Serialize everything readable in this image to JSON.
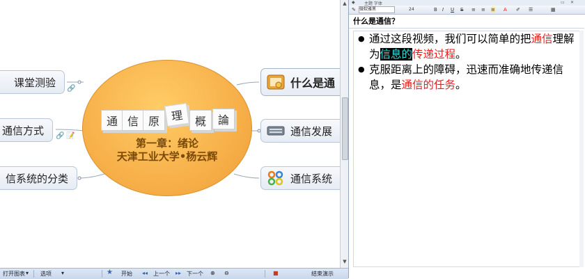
{
  "mindmap": {
    "central": {
      "cube_chars": [
        "通",
        "信",
        "原",
        "理",
        "概",
        "論"
      ],
      "line1": "第一章：绪论",
      "line2": "天津工业大学•杨云辉"
    },
    "left_topics": [
      {
        "label": "课堂测验"
      },
      {
        "label": "通信方式"
      },
      {
        "label": "信系统的分类"
      }
    ],
    "right_topics": [
      {
        "label": "什么是通",
        "icon": "picture-icon"
      },
      {
        "label": "通信发展",
        "icon": "keyboard-icon"
      },
      {
        "label": "通信系统",
        "icon": "network-icon"
      }
    ]
  },
  "statusbar": {
    "open_map": "打开图表",
    "options": "选项",
    "home": "开始",
    "prev": "上一个",
    "next": "下一个",
    "end_show": "结束演示"
  },
  "notes": {
    "toolbar_text": "主题  字体",
    "font_name": "微软雅黑",
    "font_size": "24",
    "title": "什么是通信？",
    "bullet1": {
      "t1": "通过这段视频，我们可以简单的把",
      "t2": "通信",
      "t3": "理解为",
      "t4": "信息的",
      "t5": "传递过程",
      "t6": "。"
    },
    "bullet2": {
      "t1": "克服距离上的障碍，迅速而准确地传递信息，是",
      "t2": "通信的任务",
      "t3": "。"
    }
  },
  "colors": {
    "central_fill": "#f7b04a",
    "accent_red": "#e41f1f",
    "highlight_bg": "#000000",
    "highlight_fg": "#33dddd"
  }
}
